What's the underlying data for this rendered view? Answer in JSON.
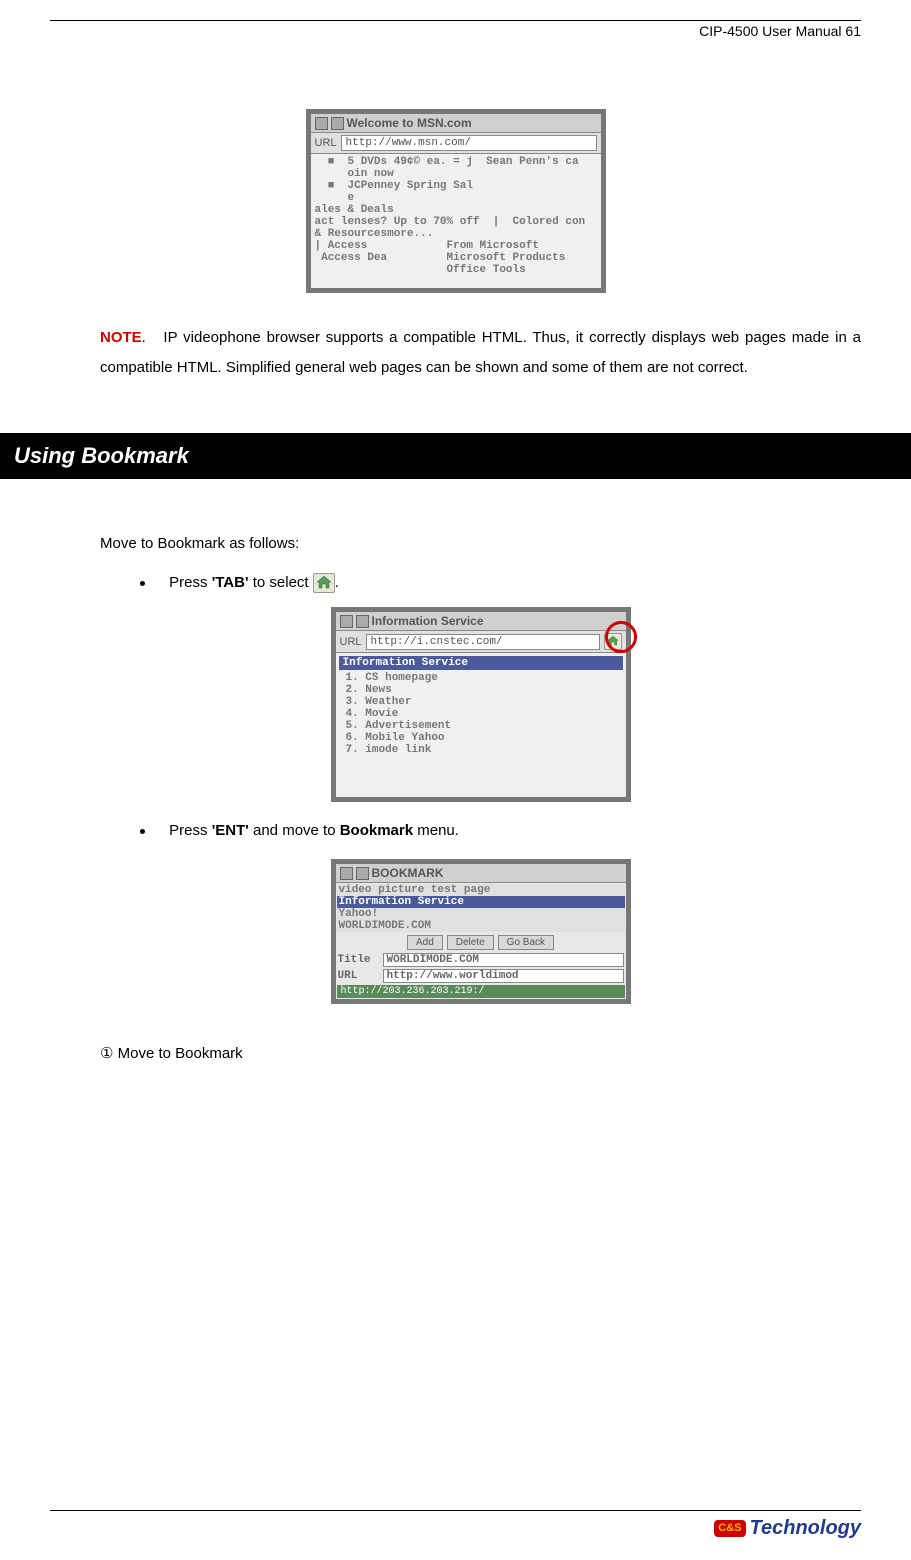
{
  "header": {
    "title": "CIP-4500 User Manual",
    "page": "61"
  },
  "fig1": {
    "title": "Welcome to MSN.com",
    "url_label": "URL",
    "url": "http://www.msn.com/",
    "lines": [
      "  ■  5 DVDs 49¢© ea. = j  Sean Penn's ca",
      "     oin now",
      "  ■  JCPenney Spring Sal",
      "     e",
      "ales & Deals",
      "act lenses? Up to 70% off  |  Colored con",
      "& Resourcesmore...",
      "| Access            From Microsoft",
      " Access Dea         Microsoft Products",
      "                    Office Tools"
    ]
  },
  "note": {
    "label": "NOTE",
    "sep": ".",
    "text": "IP videophone browser supports a compatible HTML. Thus, it correctly displays web pages made in a compatible HTML. Simplified general web pages can be shown and some of them are not correct."
  },
  "section": {
    "title": "Using Bookmark"
  },
  "intro": "Move to Bookmark as follows:",
  "bullet1": {
    "prefix": "Press ",
    "key": "'TAB'",
    "mid": " to select ",
    "suffix": "."
  },
  "fig2": {
    "title": "Information Service",
    "url_label": "URL",
    "url": "http://i.cnstec.com/",
    "heading": "Information Service",
    "items": [
      "1. CS homepage",
      "2. News",
      "3. Weather",
      "4. Movie",
      "5. Advertisement",
      "6. Mobile Yahoo",
      "7. imode link"
    ]
  },
  "bullet2": {
    "prefix": "Press ",
    "key": "'ENT'",
    "mid": " and move to ",
    "target": "Bookmark",
    "suffix": " menu."
  },
  "fig3": {
    "title": "BOOKMARK",
    "rows": [
      "video picture test page",
      "Information Service",
      "Yahoo!",
      "WORLDIMODE.COM"
    ],
    "selected_index": 1,
    "buttons": [
      "Add",
      "Delete",
      "Go Back"
    ],
    "title_label": "Title",
    "title_val": "WORLDIMODE.COM",
    "url_label": "URL",
    "url_val": "http://www.worldimod",
    "status": "http://203.236.203.219:/"
  },
  "step1": {
    "num": "①",
    "text": " Move to Bookmark"
  },
  "footer": {
    "brand_badge": "C&S",
    "brand_text": "Technology"
  }
}
